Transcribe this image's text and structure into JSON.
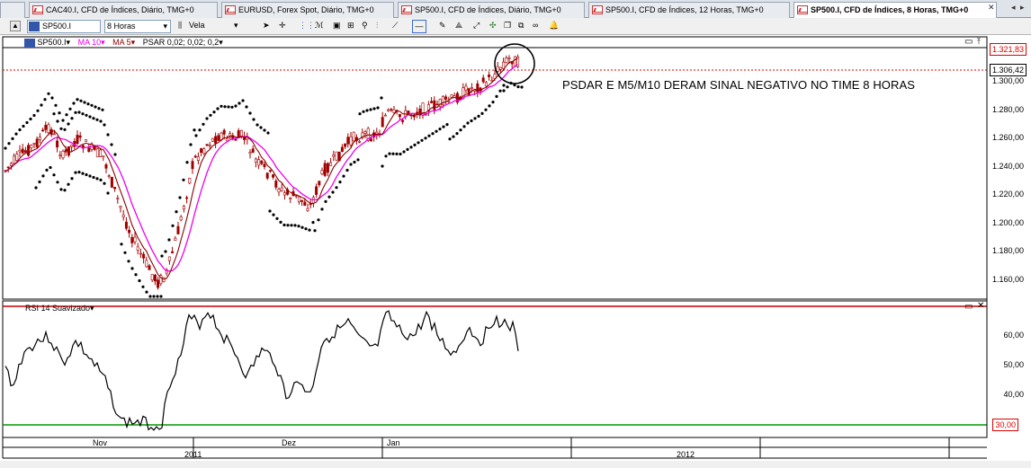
{
  "tabs": [
    {
      "label": "",
      "active": false
    },
    {
      "label": "CAC40.I, CFD de Índices, Diário, TMG+0",
      "active": false
    },
    {
      "label": "EURUSD, Forex Spot, Diário, TMG+0",
      "active": false
    },
    {
      "label": "SP500.I, CFD de Índices, Diário, TMG+0",
      "active": false
    },
    {
      "label": "SP500.I, CFD de Índices, 12 Horas, TMG+0",
      "active": false
    },
    {
      "label": "SP500.I, CFD de Índices, 8 Horas, TMG+0",
      "active": true
    }
  ],
  "toolbar": {
    "symbol": "SP500.I",
    "timeframe": "8 Horas",
    "chart_type": "Vela"
  },
  "legend": {
    "symbol": "SP500.I",
    "ma10": "MA 10",
    "ma5": "MA 5",
    "psar": "PSAR 0,02; 0,02; 0,2"
  },
  "annotation": "PSDAR E M5/M10 DERAM SINAL NEGATIVO NO TIME 8 HORAS",
  "price_axis": {
    "labels": [
      "1.300,00",
      "1.280,00",
      "1.260,00",
      "1.240,00",
      "1.220,00",
      "1.200,00",
      "1.180,00",
      "1.160,00"
    ],
    "box_high": "1.321,83",
    "box_last": "1.306,42"
  },
  "rsi": {
    "label": "RSI 14 Suavizado",
    "labels": [
      "60,00",
      "50,00",
      "40,00"
    ],
    "level_low": "30,00"
  },
  "time_axis": {
    "months": [
      "Nov",
      "Dez",
      "Jan"
    ],
    "years": [
      "2011",
      "2012"
    ]
  },
  "colors": {
    "candle": "#a00000",
    "ma10": "#ee00ee",
    "ma5": "#8b0000",
    "psar": "#000000",
    "rsi_high_line": "#cc0000",
    "rsi_low_line": "#009900",
    "bid_line": "#dd0000"
  }
}
